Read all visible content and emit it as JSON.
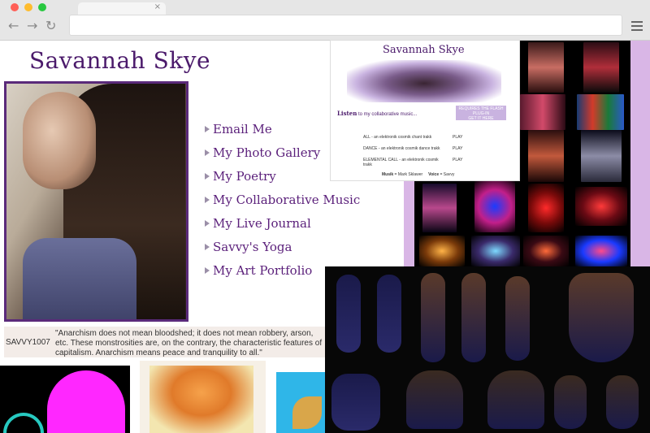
{
  "browser": {
    "dots": [
      "#ff5f57",
      "#febc2e",
      "#28c840"
    ],
    "tab_close": "×",
    "back_icon": "←",
    "forward_icon": "→",
    "reload_icon": "↻"
  },
  "site": {
    "title": "Savannah Skye",
    "menu": [
      "Email Me",
      "My Photo Gallery",
      "My Poetry",
      "My Collaborative Music",
      "My Live Journal",
      "Savvy's Yoga",
      "My Art Portfolio"
    ]
  },
  "quote": {
    "id": "SAVVY1007",
    "text": "\"Anarchism does not mean bloodshed; it does not mean robbery, arson, etc. These monstrosities are, on the contrary, the characteristic features of capitalism. Anarchism means peace and tranquility to all.\""
  },
  "music_panel": {
    "title": "Savannah Skye",
    "listen": "Listen",
    "listen_sub": "to my collaborative music...",
    "requires": "REQUIRES THE FLASH PLUG-IN",
    "get_it": "GET IT HERE",
    "tracks": [
      {
        "label": "ALL  - an elektronik cosmik chant trakk",
        "action": "PLAY"
      },
      {
        "label": "DANCE - an elektronik cosmik dance trakk",
        "action": "PLAY"
      },
      {
        "label": "ELEMENTAL CALL - an elektronik cosmik trakk",
        "action": "PLAY"
      }
    ],
    "credit_musik": "Musik",
    "credit_musik_by": "Mark Sklawer",
    "credit_voice": "Voice",
    "credit_voice_by": "Savvy"
  },
  "colors": {
    "brand_purple": "#4b1a6b",
    "lavender": "#d9b6e6",
    "quote_bg": "#f3ece8"
  }
}
